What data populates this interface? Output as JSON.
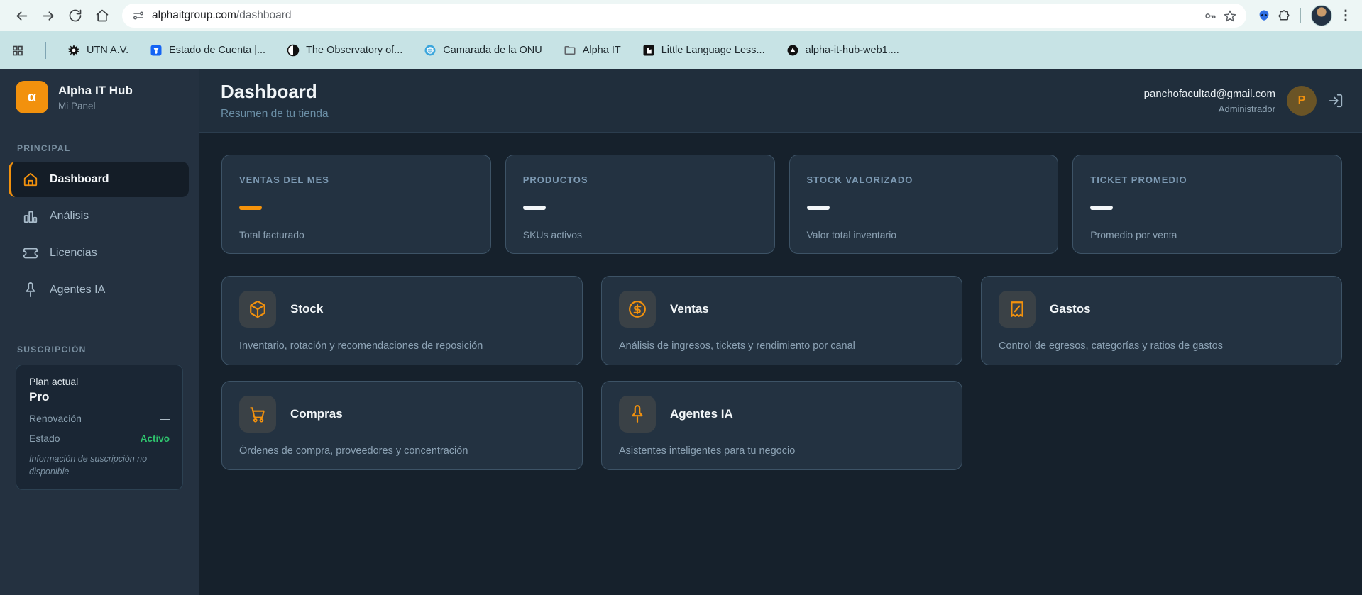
{
  "browser": {
    "url_domain": "alphaitgroup.com",
    "url_path": "/dashboard",
    "bookmarks": [
      {
        "label": "UTN A.V.",
        "icon": "utn-logo-icon"
      },
      {
        "label": "Estado de Cuenta |...",
        "icon": "shield-icon"
      },
      {
        "label": "The Observatory of...",
        "icon": "observatory-icon"
      },
      {
        "label": "Camarada de la ONU",
        "icon": "globe-icon"
      },
      {
        "label": "Alpha IT",
        "icon": "folder-icon"
      },
      {
        "label": "Little Language Less...",
        "icon": "language-icon"
      },
      {
        "label": "alpha-it-hub-web1....",
        "icon": "vercel-icon"
      }
    ]
  },
  "sidebar": {
    "brand": {
      "logo": "α",
      "title": "Alpha IT Hub",
      "subtitle": "Mi Panel"
    },
    "sections": {
      "principal": "PRINCIPAL",
      "subscription": "SUSCRIPCIÓN"
    },
    "items": [
      {
        "label": "Dashboard",
        "icon": "home-icon",
        "active": true
      },
      {
        "label": "Análisis",
        "icon": "bar-chart-icon",
        "active": false
      },
      {
        "label": "Licencias",
        "icon": "ticket-icon",
        "active": false
      },
      {
        "label": "Agentes IA",
        "icon": "pin-bot-icon",
        "active": false
      }
    ],
    "subscription": {
      "plan_label": "Plan actual",
      "plan_name": "Pro",
      "renewal_label": "Renovación",
      "renewal_value": "—",
      "status_label": "Estado",
      "status_value": "Activo",
      "note": "Información de suscripción no disponible"
    }
  },
  "header": {
    "title": "Dashboard",
    "subtitle": "Resumen de tu tienda",
    "email": "panchofacultad@gmail.com",
    "role": "Administrador",
    "avatar_initial": "P"
  },
  "stats": [
    {
      "label": "VENTAS DEL MES",
      "value": "—",
      "caption": "Total facturado",
      "accent": "#F5930B"
    },
    {
      "label": "PRODUCTOS",
      "value": "—",
      "caption": "SKUs activos",
      "accent": "#F2F6F8"
    },
    {
      "label": "STOCK VALORIZADO",
      "value": "—",
      "caption": "Valor total inventario",
      "accent": "#F2F6F8"
    },
    {
      "label": "TICKET PROMEDIO",
      "value": "—",
      "caption": "Promedio por venta",
      "accent": "#F2F6F8"
    }
  ],
  "modules": [
    {
      "title": "Stock",
      "description": "Inventario, rotación y recomendaciones de reposición",
      "icon": "package-icon"
    },
    {
      "title": "Ventas",
      "description": "Análisis de ingresos, tickets y rendimiento por canal",
      "icon": "dollar-circle-icon"
    },
    {
      "title": "Gastos",
      "description": "Control de egresos, categorías y ratios de gastos",
      "icon": "receipt-icon"
    },
    {
      "title": "Compras",
      "description": "Órdenes de compra, proveedores y concentración",
      "icon": "cart-icon"
    },
    {
      "title": "Agentes IA",
      "description": "Asistentes inteligentes para tu negocio",
      "icon": "pin-bot-icon"
    }
  ],
  "colors": {
    "accent_orange": "#F2910D",
    "status_green": "#2FC46E",
    "sidebar_bg": "#243140",
    "content_bg": "#16212C",
    "card_bg": "#233241",
    "bookmarks_bar_bg": "#C7E3E5"
  }
}
